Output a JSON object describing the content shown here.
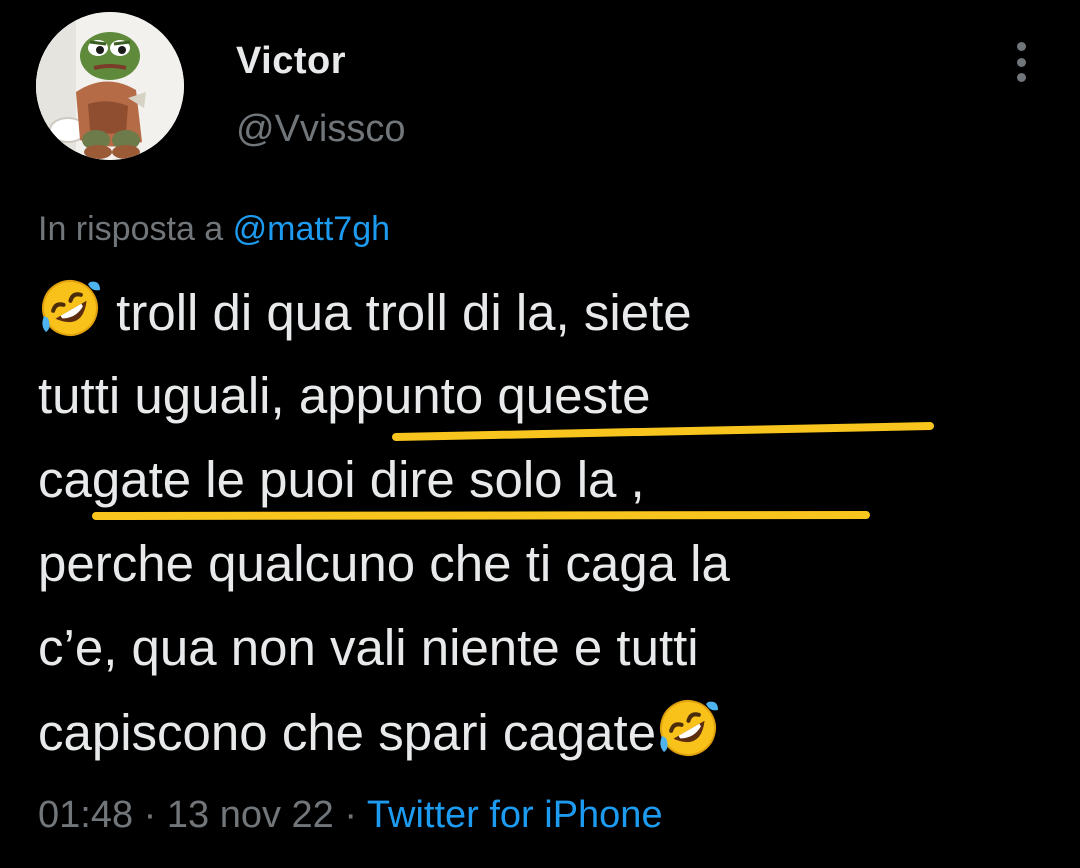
{
  "user": {
    "display_name": "Victor",
    "handle": "@Vvissco"
  },
  "icons": {
    "more": "more-options-icon",
    "emoji": "rolling-on-the-floor-laughing-emoji"
  },
  "reply": {
    "prefix": "In risposta a",
    "mention": "@matt7gh"
  },
  "tweet": {
    "line1": "troll di qua troll di la, siete",
    "line2_a": "tutti uguali, ",
    "line2_b": "appunto queste",
    "line3": "cagate le puoi dire solo la ,",
    "line4": "perche qualcuno che ti caga la",
    "line5": "c’e, qua non vali niente e tutti",
    "line6": "capiscono che spari cagate"
  },
  "meta": {
    "time": "01:48",
    "sep1": " · ",
    "date": "13 nov 22",
    "sep2": " · ",
    "source": "Twitter for iPhone"
  },
  "colors": {
    "background": "#000000",
    "text": "#e7e9ea",
    "secondary": "#71767b",
    "link": "#1d9bf0",
    "highlight_underline": "#f7c51d"
  }
}
